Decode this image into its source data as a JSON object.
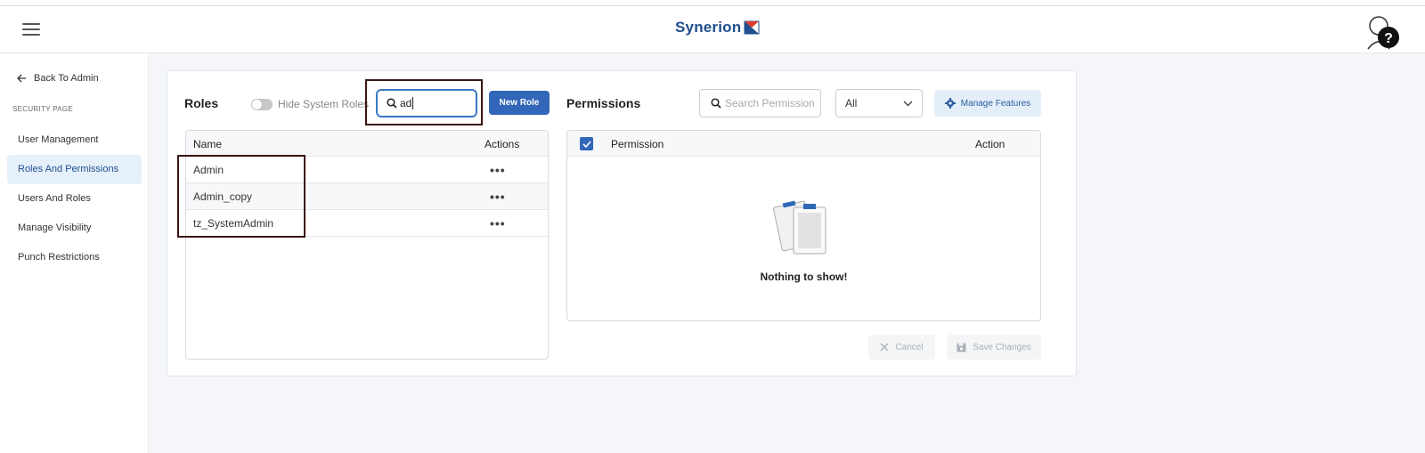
{
  "header": {
    "logo_text": "Synerion",
    "help_icon": "help-question-icon"
  },
  "sidebar": {
    "back_label": "Back To Admin",
    "section_label": "SECURITY PAGE",
    "items": [
      {
        "label": "User Management",
        "active": false
      },
      {
        "label": "Roles And Permissions",
        "active": true
      },
      {
        "label": "Users And Roles",
        "active": false
      },
      {
        "label": "Manage Visibility",
        "active": false
      },
      {
        "label": "Punch Restrictions",
        "active": false
      }
    ]
  },
  "roles": {
    "title": "Roles",
    "toggle_label": "Hide System Roles",
    "toggle_on": false,
    "search_value": "ad",
    "new_button": "New Role",
    "columns": {
      "name": "Name",
      "actions": "Actions"
    },
    "rows": [
      {
        "name": "Admin",
        "actions": "•••"
      },
      {
        "name": "Admin_copy",
        "actions": "•••"
      },
      {
        "name": "tz_SystemAdmin",
        "actions": "•••"
      }
    ]
  },
  "permissions": {
    "title": "Permissions",
    "search_placeholder": "Search Permission",
    "filter_value": "All",
    "manage_button": "Manage Features",
    "columns": {
      "permission": "Permission",
      "action": "Action"
    },
    "empty_text": "Nothing to show!",
    "cancel_button": "Cancel",
    "save_button": "Save Changes"
  },
  "colors": {
    "accent": "#3266b8",
    "active_nav_bg": "#e6f0fb",
    "highlight_border": "#3b1414"
  }
}
